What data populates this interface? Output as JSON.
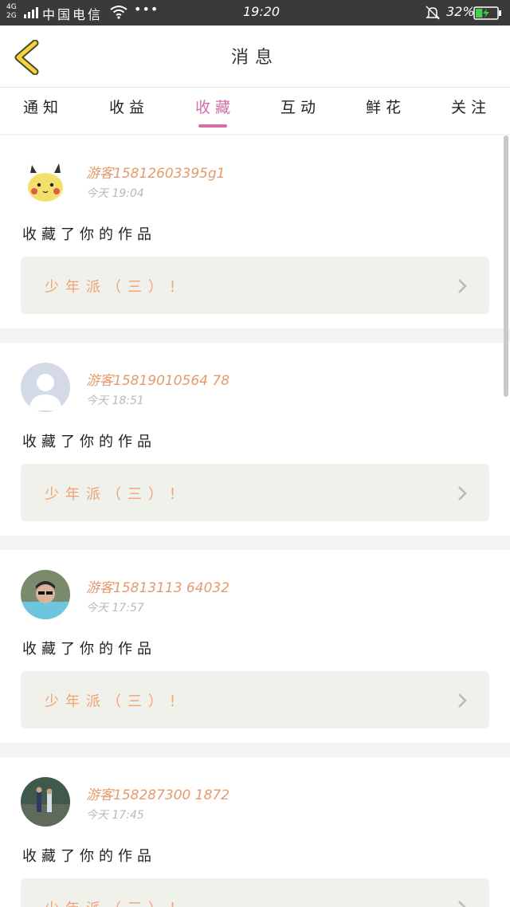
{
  "status_bar": {
    "network": "4G",
    "network2": "2G",
    "carrier": "中国电信",
    "time": "19:20",
    "battery_percent": "32%",
    "battery_level": 0.32,
    "icons": [
      "signal-icon",
      "wifi-icon",
      "more-dots-icon",
      "bell-muted-icon",
      "battery-icon"
    ]
  },
  "header": {
    "title": "消息",
    "back_icon": "chevron-left-icon"
  },
  "tabs": [
    {
      "label": "通知",
      "active": false
    },
    {
      "label": "收益",
      "active": false
    },
    {
      "label": "收藏",
      "active": true
    },
    {
      "label": "互动",
      "active": false
    },
    {
      "label": "鲜花",
      "active": false
    },
    {
      "label": "关注",
      "active": false
    }
  ],
  "notifications": [
    {
      "user": "游客15812603395g1",
      "time_prefix": "今天",
      "time": "19:04",
      "action": "收藏了你的作品",
      "work": "少年派（三）！",
      "avatar": "pikachu"
    },
    {
      "user": "游客15819010564 78",
      "time_prefix": "今天",
      "time": "18:51",
      "action": "收藏了你的作品",
      "work": "少年派（三）！",
      "avatar": "default"
    },
    {
      "user": "游客15813113 64032",
      "time_prefix": "今天",
      "time": "17:57",
      "action": "收藏了你的作品",
      "work": "少年派（三）！",
      "avatar": "photo1"
    },
    {
      "user": "游客158287300 1872",
      "time_prefix": "今天",
      "time": "17:45",
      "action": "收藏了你的作品",
      "work": "少年派（三）！",
      "avatar": "photo2"
    }
  ],
  "colors": {
    "accent_pink": "#d56ea6",
    "orange_text": "#e59a6c",
    "back_yellow": "#f5d33a"
  }
}
